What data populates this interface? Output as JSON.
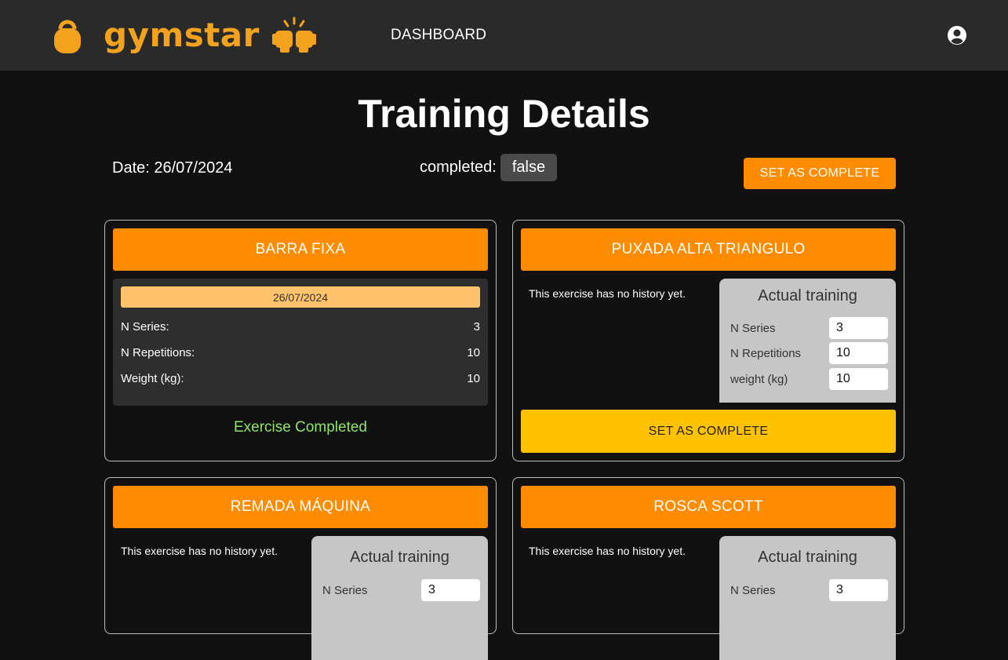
{
  "header": {
    "brand": "gymstar",
    "nav_dashboard": "DASHBOARD",
    "brand_color": "#f2a21c"
  },
  "page": {
    "title": "Training Details",
    "date_label": "Date: 26/07/2024",
    "completed_label": "completed:",
    "completed_value": "false",
    "set_complete_label": "SET AS COMPLETE"
  },
  "colors": {
    "accent": "#ff8c00",
    "complete_button": "#ffc200",
    "completed_text": "#8fe36b"
  },
  "exercises": [
    {
      "name": "BARRA FIXA",
      "history": {
        "date": "26/07/2024",
        "series_label": "N Series:",
        "series_value": "3",
        "reps_label": "N Repetitions:",
        "reps_value": "10",
        "weight_label": "Weight (kg):",
        "weight_value": "10"
      },
      "status": "Exercise Completed"
    },
    {
      "name": "PUXADA ALTA TRIANGULO",
      "no_history": "This exercise has no history yet.",
      "actual": {
        "title": "Actual training",
        "series_label": "N Series",
        "series_value": "3",
        "reps_label": "N Repetitions",
        "reps_value": "10",
        "weight_label": "weight (kg)",
        "weight_value": "10"
      },
      "button": "SET AS COMPLETE"
    },
    {
      "name": "REMADA MÁQUINA",
      "no_history": "This exercise has no history yet.",
      "actual": {
        "title": "Actual training",
        "series_label": "N Series",
        "series_value": "3"
      }
    },
    {
      "name": "ROSCA SCOTT",
      "no_history": "This exercise has no history yet.",
      "actual": {
        "title": "Actual training",
        "series_label": "N Series",
        "series_value": "3"
      }
    }
  ]
}
